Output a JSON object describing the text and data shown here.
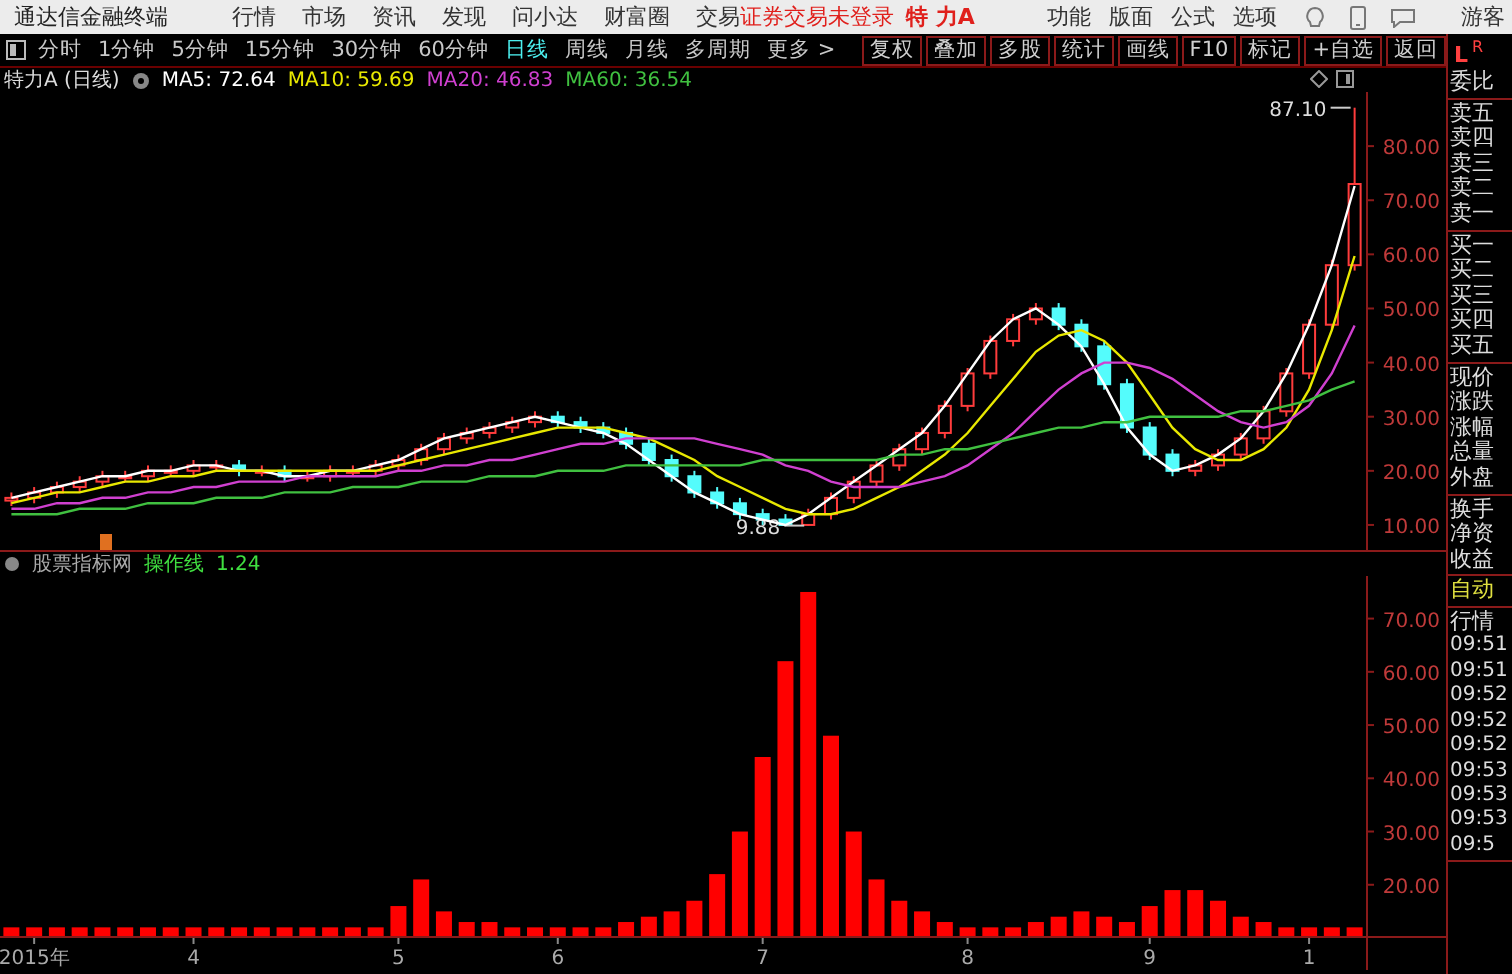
{
  "menubar": {
    "app_title": "通达信金融终端",
    "menus": [
      "行情",
      "市场",
      "资讯",
      "发现",
      "问小达",
      "财富圈",
      "交易"
    ],
    "login_status": "证券交易未登录",
    "stock": "特 力A",
    "right_menus": [
      "功能",
      "版面",
      "公式",
      "选项"
    ],
    "user": "游客"
  },
  "toolbar": {
    "periods": [
      {
        "label": "分时",
        "selected": false
      },
      {
        "label": "1分钟",
        "selected": false
      },
      {
        "label": "5分钟",
        "selected": false
      },
      {
        "label": "15分钟",
        "selected": false
      },
      {
        "label": "30分钟",
        "selected": false
      },
      {
        "label": "60分钟",
        "selected": false
      },
      {
        "label": "日线",
        "selected": true
      },
      {
        "label": "周线",
        "selected": false
      },
      {
        "label": "月线",
        "selected": false
      },
      {
        "label": "多周期",
        "selected": false
      },
      {
        "label": "更多 >",
        "selected": false
      }
    ],
    "actions": [
      "复权",
      "叠加",
      "多股",
      "统计",
      "画线",
      "F10",
      "标记",
      "+自选",
      "返回"
    ]
  },
  "price_chart": {
    "title": "特力A (日线)",
    "chart_data": {
      "type": "candlestick",
      "ohlc": [
        [
          14.5,
          16,
          13.5,
          15
        ],
        [
          15,
          17,
          14,
          16
        ],
        [
          16,
          18,
          15,
          17
        ],
        [
          17,
          19,
          16,
          18
        ],
        [
          18,
          20,
          17,
          19
        ],
        [
          19,
          20,
          18,
          19
        ],
        [
          19,
          21,
          18,
          20
        ],
        [
          20,
          21,
          19,
          20
        ],
        [
          20,
          22,
          19,
          21
        ],
        [
          21,
          22,
          20,
          21
        ],
        [
          21,
          22,
          19,
          20
        ],
        [
          20,
          21,
          19,
          20
        ],
        [
          20,
          21,
          18,
          19
        ],
        [
          19,
          20,
          18,
          19
        ],
        [
          19,
          21,
          18,
          20
        ],
        [
          20,
          21,
          19,
          20
        ],
        [
          20,
          22,
          19,
          21
        ],
        [
          21,
          23,
          20,
          22
        ],
        [
          22,
          25,
          21,
          24
        ],
        [
          24,
          27,
          23,
          26
        ],
        [
          26,
          28,
          25,
          27
        ],
        [
          27,
          29,
          26,
          28
        ],
        [
          28,
          30,
          27,
          29
        ],
        [
          29,
          31,
          28,
          30
        ],
        [
          30,
          31,
          28,
          29
        ],
        [
          29,
          30,
          27,
          28
        ],
        [
          28,
          29,
          26,
          27
        ],
        [
          27,
          28,
          24,
          25
        ],
        [
          25,
          26,
          21,
          22
        ],
        [
          22,
          23,
          18,
          19
        ],
        [
          19,
          20,
          15,
          16
        ],
        [
          16,
          17,
          13,
          14
        ],
        [
          14,
          15,
          11,
          12
        ],
        [
          12,
          13,
          10,
          11
        ],
        [
          11,
          12,
          10,
          10
        ],
        [
          10,
          13,
          9.88,
          12
        ],
        [
          12,
          16,
          11,
          15
        ],
        [
          15,
          19,
          14,
          18
        ],
        [
          18,
          22,
          17,
          21
        ],
        [
          21,
          25,
          20,
          24
        ],
        [
          24,
          28,
          23,
          27
        ],
        [
          27,
          33,
          26,
          32
        ],
        [
          32,
          39,
          31,
          38
        ],
        [
          38,
          45,
          37,
          44
        ],
        [
          44,
          49,
          43,
          48
        ],
        [
          48,
          51,
          47,
          50
        ],
        [
          50,
          51,
          46,
          47
        ],
        [
          47,
          48,
          42,
          43
        ],
        [
          43,
          44,
          35,
          36
        ],
        [
          36,
          37,
          27,
          28
        ],
        [
          28,
          29,
          22,
          23
        ],
        [
          23,
          24,
          19,
          20
        ],
        [
          20,
          22,
          19,
          21
        ],
        [
          21,
          24,
          20,
          23
        ],
        [
          23,
          27,
          22,
          26
        ],
        [
          26,
          32,
          25,
          31
        ],
        [
          31,
          39,
          30,
          38
        ],
        [
          38,
          48,
          37,
          47
        ],
        [
          47,
          59,
          46,
          58
        ],
        [
          58,
          87.1,
          57,
          73
        ]
      ],
      "annotations": [
        "87.10",
        "9.88"
      ]
    },
    "moving_averages": {
      "legend": [
        ": 72.64",
        ": 59.69",
        ": 46.83",
        ": 36.54"
      ],
      "chart_data": {
        "type": "line",
        "ylim": [
          5,
          90
        ],
        "yticks": [
          {
            "value": 10,
            "label": "10.00"
          },
          {
            "value": 20,
            "label": "20.00"
          },
          {
            "value": 30,
            "label": "30.00"
          },
          {
            "value": 40,
            "label": "40.00"
          },
          {
            "value": 50,
            "label": "50.00"
          },
          {
            "value": 60,
            "label": "60.00"
          },
          {
            "value": 70,
            "label": "70.00"
          },
          {
            "value": 80,
            "label": "80.00"
          }
        ],
        "series": [
          {
            "name": "MA5",
            "color": "#ffffff",
            "values": [
              15,
              16,
              17,
              18,
              19,
              19,
              20,
              20,
              21,
              21,
              20,
              20,
              19,
              19,
              20,
              20,
              21,
              22,
              24,
              26,
              27,
              28,
              29,
              30,
              29,
              28,
              27,
              25,
              22,
              19,
              16,
              14,
              12,
              11,
              10,
              12,
              15,
              18,
              21,
              24,
              27,
              32,
              38,
              44,
              48,
              50,
              47,
              43,
              36,
              28,
              23,
              20,
              21,
              23,
              26,
              31,
              38,
              47,
              58,
              72.64
            ]
          },
          {
            "name": "MA10",
            "color": "#e8e800",
            "values": [
              14,
              15,
              16,
              16,
              17,
              18,
              18,
              19,
              19,
              20,
              20,
              20,
              20,
              20,
              20,
              20,
              20,
              21,
              22,
              23,
              24,
              25,
              26,
              27,
              28,
              28,
              28,
              27,
              26,
              24,
              22,
              19,
              17,
              15,
              13,
              12,
              12,
              13,
              15,
              17,
              20,
              23,
              27,
              32,
              37,
              42,
              45,
              46,
              44,
              40,
              34,
              28,
              24,
              22,
              22,
              24,
              28,
              35,
              46,
              59.69
            ]
          },
          {
            "name": "MA20",
            "color": "#d040d0",
            "values": [
              13,
              13,
              14,
              14,
              15,
              15,
              16,
              16,
              17,
              17,
              18,
              18,
              18,
              19,
              19,
              19,
              19,
              20,
              20,
              21,
              21,
              22,
              22,
              23,
              24,
              25,
              25,
              26,
              26,
              26,
              26,
              25,
              24,
              23,
              21,
              20,
              18,
              17,
              17,
              17,
              18,
              19,
              21,
              24,
              27,
              31,
              35,
              38,
              40,
              40,
              39,
              37,
              34,
              31,
              29,
              28,
              29,
              32,
              38,
              46.83
            ]
          },
          {
            "name": "MA60",
            "color": "#40c040",
            "values": [
              12,
              12,
              12,
              13,
              13,
              13,
              14,
              14,
              14,
              15,
              15,
              15,
              16,
              16,
              16,
              17,
              17,
              17,
              18,
              18,
              18,
              19,
              19,
              19,
              20,
              20,
              20,
              21,
              21,
              21,
              21,
              21,
              21,
              22,
              22,
              22,
              22,
              22,
              22,
              23,
              23,
              24,
              24,
              25,
              26,
              27,
              28,
              28,
              29,
              29,
              30,
              30,
              30,
              30,
              31,
              31,
              32,
              33,
              35,
              36.54
            ]
          }
        ]
      }
    }
  },
  "indicator": {
    "name": "股票指标网",
    "value": "1.24",
    "chart_data": {
      "type": "bar",
      "categories": [
        null,
        "2015年",
        null,
        null,
        null,
        null,
        null,
        null,
        "4",
        null,
        null,
        null,
        null,
        null,
        null,
        null,
        null,
        "5",
        null,
        null,
        null,
        null,
        null,
        null,
        "6",
        null,
        null,
        null,
        null,
        null,
        null,
        null,
        null,
        "7",
        null,
        null,
        null,
        null,
        null,
        null,
        null,
        null,
        "8",
        null,
        null,
        null,
        null,
        null,
        null,
        null,
        "9",
        null,
        null,
        null,
        null,
        null,
        null,
        "1",
        null,
        null
      ],
      "ylim": [
        10,
        78
      ],
      "yticks": [
        {
          "value": 20,
          "label": "20.00"
        },
        {
          "value": 30,
          "label": "30.00"
        },
        {
          "value": 40,
          "label": "40.00"
        },
        {
          "value": 50,
          "label": "50.00"
        },
        {
          "value": 60,
          "label": "60.00"
        },
        {
          "value": 70,
          "label": "70.00"
        }
      ],
      "series": [
        {
          "name": "操作线",
          "color": "#ff0000",
          "values": [
            12,
            12,
            12,
            12,
            12,
            12,
            12,
            12,
            12,
            12,
            12,
            12,
            12,
            12,
            12,
            12,
            12,
            16,
            21,
            15,
            13,
            13,
            12,
            12,
            12,
            12,
            12,
            13,
            14,
            15,
            17,
            22,
            30,
            44,
            62,
            75,
            48,
            30,
            21,
            17,
            15,
            13,
            12,
            12,
            12,
            13,
            14,
            15,
            14,
            13,
            16,
            19,
            19,
            17,
            14,
            13,
            12,
            12,
            12,
            12
          ]
        }
      ]
    }
  },
  "side_panel": {
    "badge": {
      "left": "L",
      "right": "R"
    },
    "sections": [
      [
        {
          "text": "委比",
          "kind": "label"
        }
      ],
      [
        {
          "text": "卖五",
          "kind": "label"
        },
        {
          "text": "卖四",
          "kind": "label"
        },
        {
          "text": "卖三",
          "kind": "label"
        },
        {
          "text": "卖二",
          "kind": "label"
        },
        {
          "text": "卖一",
          "kind": "label"
        }
      ],
      [
        {
          "text": "买一",
          "kind": "label"
        },
        {
          "text": "买二",
          "kind": "label"
        },
        {
          "text": "买三",
          "kind": "label"
        },
        {
          "text": "买四",
          "kind": "label"
        },
        {
          "text": "买五",
          "kind": "label"
        }
      ],
      [
        {
          "text": "现价",
          "kind": "label"
        },
        {
          "text": "涨跌",
          "kind": "label"
        },
        {
          "text": "涨幅",
          "kind": "label"
        },
        {
          "text": "总量",
          "kind": "label"
        },
        {
          "text": "外盘",
          "kind": "label"
        }
      ],
      [
        {
          "text": "换手",
          "kind": "label"
        },
        {
          "text": "净资",
          "kind": "label"
        },
        {
          "text": "收益",
          "kind": "label"
        }
      ],
      [
        {
          "text": "自动",
          "kind": "mode"
        }
      ],
      [
        {
          "text": "行情",
          "kind": "label"
        },
        {
          "text": "09:51",
          "kind": "time"
        },
        {
          "text": "09:51",
          "kind": "time"
        },
        {
          "text": "09:52",
          "kind": "time"
        },
        {
          "text": "09:52",
          "kind": "time"
        },
        {
          "text": "09:52",
          "kind": "time"
        },
        {
          "text": "09:53",
          "kind": "time"
        },
        {
          "text": "09:53",
          "kind": "time"
        },
        {
          "text": "09:53",
          "kind": "time"
        },
        {
          "text": "09:5",
          "kind": "time"
        }
      ]
    ]
  }
}
